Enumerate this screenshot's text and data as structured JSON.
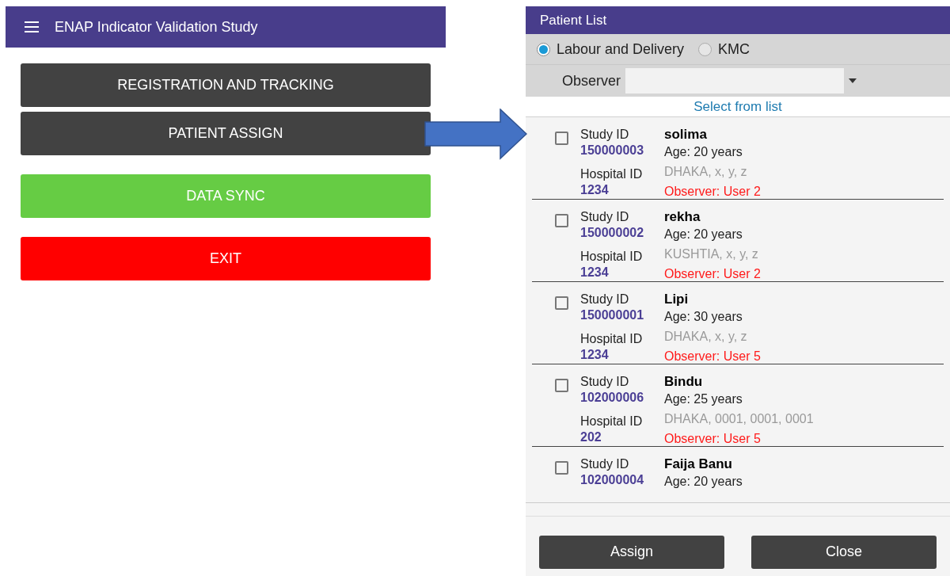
{
  "main_screen": {
    "title": "ENAP Indicator Validation Study",
    "buttons": [
      {
        "label": "REGISTRATION AND TRACKING",
        "kind": "dark"
      },
      {
        "label": "PATIENT ASSIGN",
        "kind": "dark"
      },
      {
        "label": "DATA SYNC",
        "kind": "green"
      },
      {
        "label": "EXIT",
        "kind": "red"
      }
    ]
  },
  "patient_list": {
    "title": "Patient List",
    "types": [
      {
        "label": "Labour and Delivery",
        "selected": true
      },
      {
        "label": "KMC",
        "selected": false
      }
    ],
    "observer": {
      "label": "Observer"
    },
    "hint": "Select from list",
    "rows": [
      {
        "checked": false,
        "study_id_label": "Study ID",
        "study_id": "150000003",
        "name": "solima",
        "age": "Age: 20 years",
        "hospital_id_label": "Hospital ID",
        "hospital_id": "1234",
        "address": "DHAKA, x, y, z",
        "observer": "Observer: User 2"
      },
      {
        "checked": false,
        "study_id_label": "Study ID",
        "study_id": "150000002",
        "name": "rekha",
        "age": "Age: 20 years",
        "hospital_id_label": "Hospital ID",
        "hospital_id": "1234",
        "address": "KUSHTIA, x, y, z",
        "observer": "Observer: User 2"
      },
      {
        "checked": false,
        "study_id_label": "Study ID",
        "study_id": "150000001",
        "name": "Lipi",
        "age": "Age: 30 years",
        "hospital_id_label": "Hospital ID",
        "hospital_id": "1234",
        "address": "DHAKA, x, y, z",
        "observer": "Observer: User 5"
      },
      {
        "checked": false,
        "study_id_label": "Study ID",
        "study_id": "102000006",
        "name": "Bindu",
        "age": "Age: 25 years",
        "hospital_id_label": "Hospital ID",
        "hospital_id": "202",
        "address": "DHAKA, 0001, 0001, 0001",
        "observer": "Observer: User 5"
      },
      {
        "checked": false,
        "study_id_label": "Study ID",
        "study_id": "102000004",
        "name": "Faija Banu",
        "age": "Age: 20 years"
      }
    ],
    "buttons": [
      "Assign",
      "Close"
    ]
  }
}
